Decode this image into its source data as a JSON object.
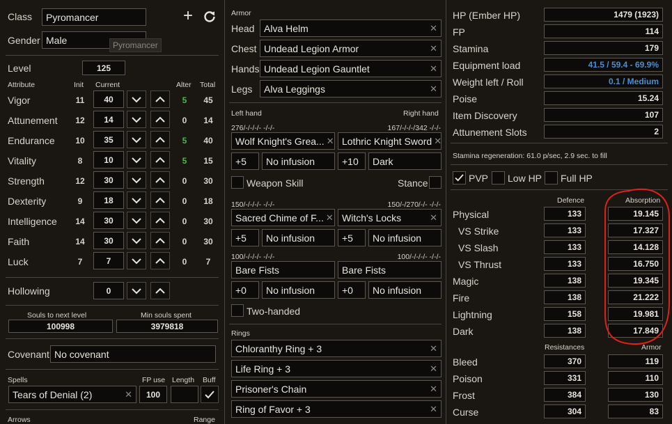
{
  "character": {
    "class_label": "Class",
    "class_value": "Pyromancer",
    "gender_label": "Gender",
    "gender_value": "Male",
    "tooltip": "Pyromancer",
    "level_label": "Level",
    "level_value": "125",
    "header_attribute": "Attribute",
    "header_init": "Init",
    "header_current": "Current",
    "header_alter": "Alter",
    "header_total": "Total",
    "attributes": [
      {
        "name": "Vigor",
        "init": "11",
        "current": "40",
        "alter": "5",
        "total": "45"
      },
      {
        "name": "Attunement",
        "init": "12",
        "current": "14",
        "alter": "0",
        "total": "14"
      },
      {
        "name": "Endurance",
        "init": "10",
        "current": "35",
        "alter": "5",
        "total": "40"
      },
      {
        "name": "Vitality",
        "init": "8",
        "current": "10",
        "alter": "5",
        "total": "15"
      },
      {
        "name": "Strength",
        "init": "12",
        "current": "30",
        "alter": "0",
        "total": "30"
      },
      {
        "name": "Dexterity",
        "init": "9",
        "current": "18",
        "alter": "0",
        "total": "18"
      },
      {
        "name": "Intelligence",
        "init": "14",
        "current": "30",
        "alter": "0",
        "total": "30"
      },
      {
        "name": "Faith",
        "init": "14",
        "current": "30",
        "alter": "0",
        "total": "30"
      },
      {
        "name": "Luck",
        "init": "7",
        "current": "7",
        "alter": "0",
        "total": "7"
      }
    ],
    "hollowing_label": "Hollowing",
    "hollowing_value": "0",
    "souls_next_label": "Souls to next level",
    "souls_next_value": "100998",
    "min_souls_label": "Min souls spent",
    "min_souls_value": "3979818",
    "covenant_label": "Covenant",
    "covenant_value": "No covenant",
    "spells_label": "Spells",
    "fp_use_label": "FP use",
    "length_label": "Length",
    "buff_label": "Buff",
    "spell_value": "Tears of Denial (2)",
    "spell_fp": "100",
    "arrows_label": "Arrows",
    "range_label": "Range"
  },
  "equipment": {
    "armor_label": "Armor",
    "armor": [
      {
        "slot": "Head",
        "item": "Alva Helm"
      },
      {
        "slot": "Chest",
        "item": "Undead Legion Armor"
      },
      {
        "slot": "Hands",
        "item": "Undead Legion Gauntlet"
      },
      {
        "slot": "Legs",
        "item": "Alva Leggings"
      }
    ],
    "left_hand_label": "Left hand",
    "right_hand_label": "Right hand",
    "sets": [
      {
        "left_stats": "276/-/-/-/-  -/-/-",
        "right_stats": "167/-/-/-/342  -/-/-",
        "left_weapon": "Wolf Knight's Grea...",
        "right_weapon": "Lothric Knight Sword",
        "left_plus": "+5",
        "left_infusion": "No infusion",
        "right_plus": "+10",
        "right_infusion": "Dark"
      },
      {
        "left_stats": "150/-/-/-/-  -/-/-",
        "right_stats": "150/-/270/-/-  -/-/-",
        "left_weapon": "Sacred Chime of F...",
        "right_weapon": "Witch's Locks",
        "left_plus": "+5",
        "left_infusion": "No infusion",
        "right_plus": "+5",
        "right_infusion": "No infusion"
      },
      {
        "left_stats": "100/-/-/-/-  -/-/-",
        "right_stats": "100/-/-/-/-  -/-/-",
        "left_weapon": "Bare Fists",
        "right_weapon": "Bare Fists",
        "left_plus": "+0",
        "left_infusion": "No infusion",
        "right_plus": "+0",
        "right_infusion": "No infusion"
      }
    ],
    "weapon_skill_label": "Weapon Skill",
    "stance_label": "Stance",
    "two_handed_label": "Two-handed",
    "rings_label": "Rings",
    "rings": [
      "Chloranthy Ring + 3",
      "Life Ring + 3",
      "Prisoner's Chain",
      "Ring of Favor + 3"
    ]
  },
  "stats": {
    "rows": [
      {
        "label": "HP (Ember HP)",
        "value": "1479 (1923)"
      },
      {
        "label": "FP",
        "value": "114"
      },
      {
        "label": "Stamina",
        "value": "179"
      },
      {
        "label": "Equipment load",
        "value": "41.5 / 59.4 - 69.9%"
      },
      {
        "label": "Weight left / Roll",
        "value": "0.1 / Medium"
      },
      {
        "label": "Poise",
        "value": "15.24"
      },
      {
        "label": "Item Discovery",
        "value": "107"
      },
      {
        "label": "Attunement Slots",
        "value": "2"
      }
    ],
    "stamina_regen": "Stamina regeneration: 61.0 p/sec, 2.9 sec. to fill",
    "pvp_label": "PVP",
    "low_hp_label": "Low HP",
    "full_hp_label": "Full HP",
    "defence_header": "Defence",
    "absorption_header": "Absorption",
    "defence": [
      {
        "label": "Physical",
        "def": "133",
        "abs": "19.145"
      },
      {
        "label": "VS Strike",
        "def": "133",
        "abs": "17.327"
      },
      {
        "label": "VS Slash",
        "def": "133",
        "abs": "14.128"
      },
      {
        "label": "VS Thrust",
        "def": "133",
        "abs": "16.750"
      },
      {
        "label": "Magic",
        "def": "138",
        "abs": "19.345"
      },
      {
        "label": "Fire",
        "def": "138",
        "abs": "21.222"
      },
      {
        "label": "Lightning",
        "def": "158",
        "abs": "19.981"
      },
      {
        "label": "Dark",
        "def": "138",
        "abs": "17.849"
      }
    ],
    "resistances_header": "Resistances",
    "armor_header": "Armor",
    "resistances": [
      {
        "label": "Bleed",
        "res": "370",
        "armor": "119"
      },
      {
        "label": "Poison",
        "res": "331",
        "armor": "110"
      },
      {
        "label": "Frost",
        "res": "384",
        "armor": "130"
      },
      {
        "label": "Curse",
        "res": "304",
        "armor": "83"
      }
    ]
  },
  "colors": {
    "accent_blue": "#4a8ed0",
    "alter_green": "#4cb84c",
    "annotation_red": "#e0201c"
  }
}
